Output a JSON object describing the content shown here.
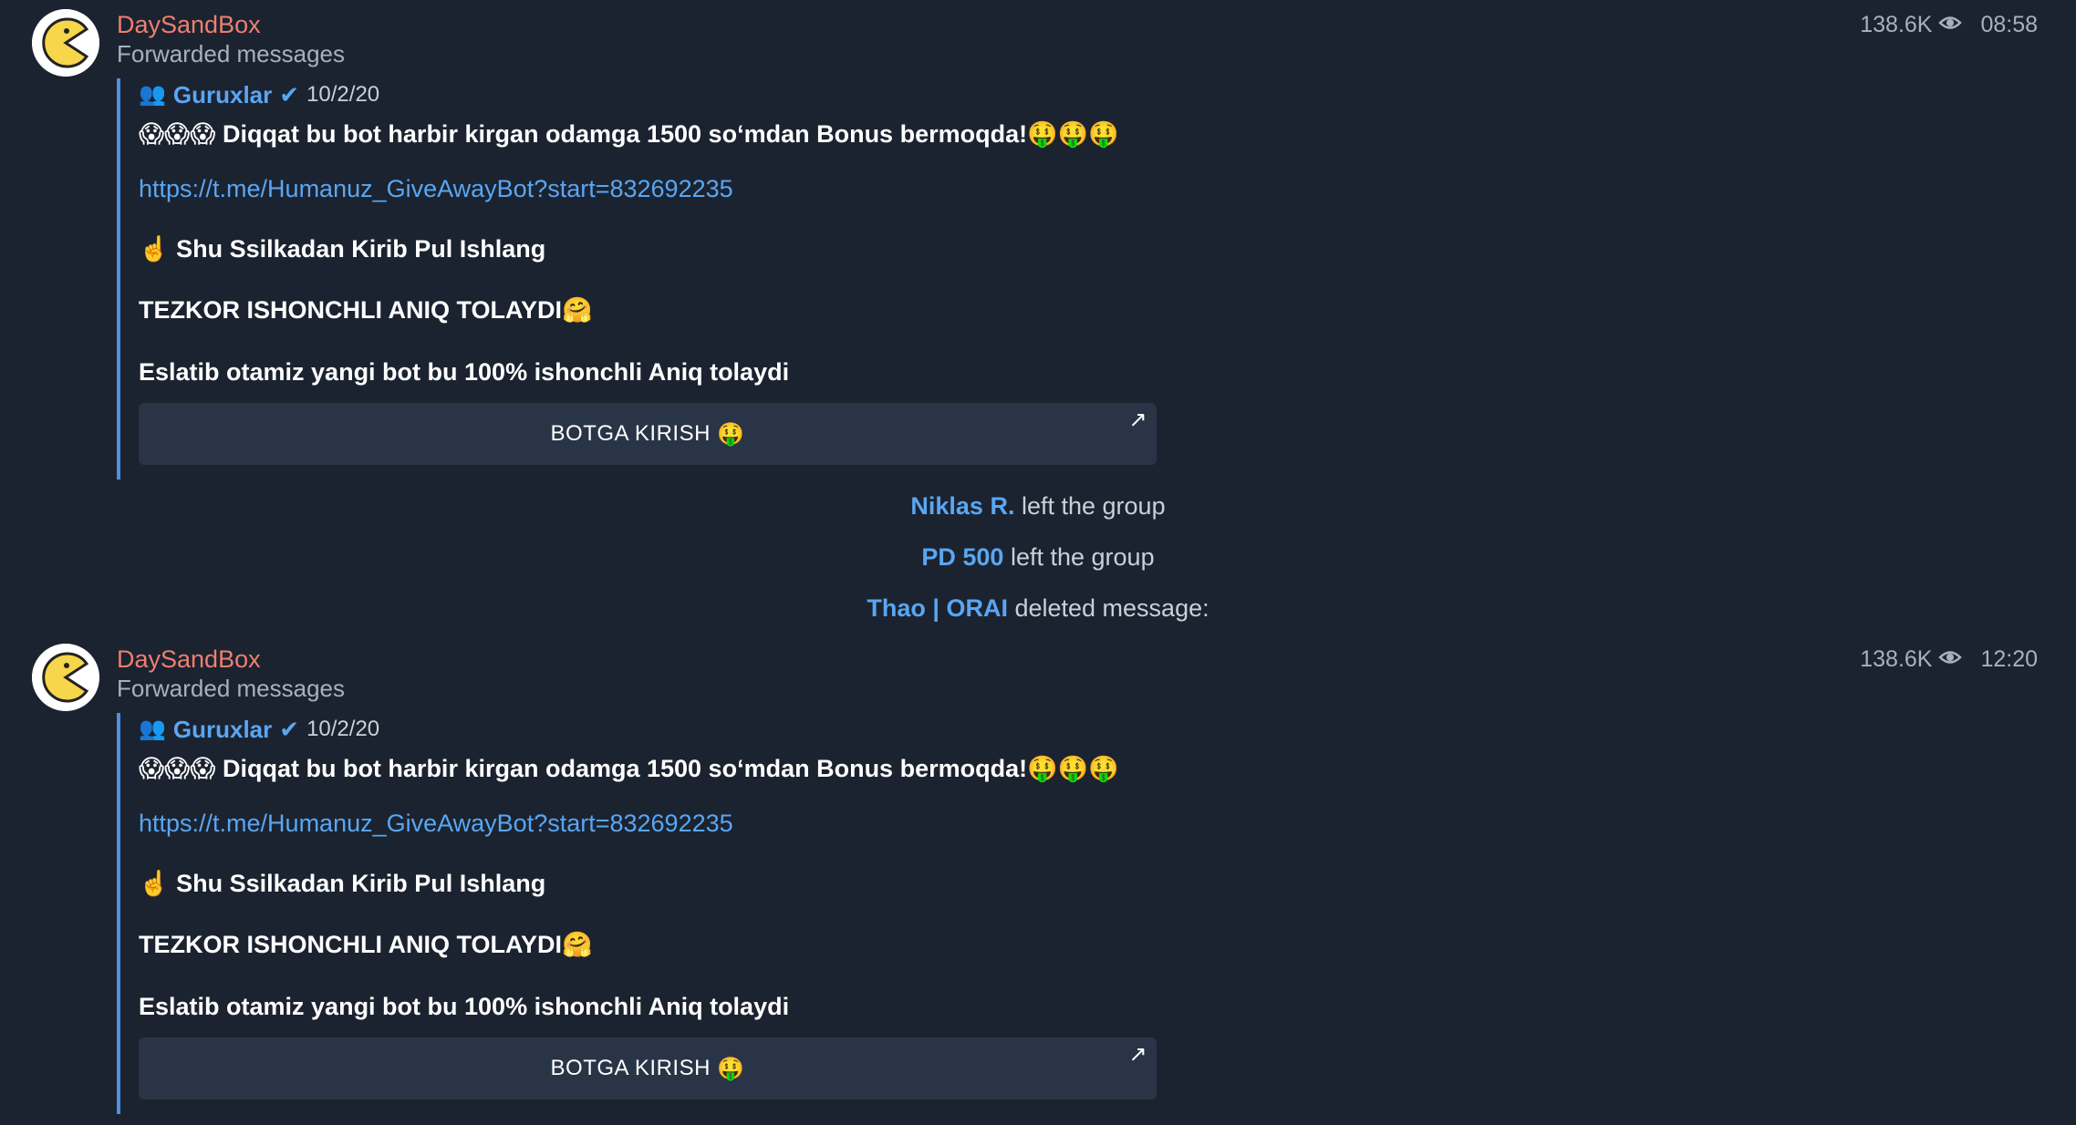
{
  "posts": [
    {
      "sender": "DaySandBox",
      "forwarded_label": "Forwarded messages",
      "views": "138.6K",
      "time": "08:58",
      "origin": {
        "group_icon": "👥",
        "name": "Guruxlar",
        "verified": "✔",
        "date": "10/2/20"
      },
      "lines": {
        "headline_emoji_start": "😱😱😱",
        "headline": "Diqqat bu bot harbir kirgan odamga 1500 so‘mdan Bonus bermoqda!",
        "headline_emoji_end": "🤑🤑🤑",
        "link": "https://t.me/Humanuz_GiveAwayBot?start=832692235",
        "pointer_emoji": "☝️",
        "cta": "Shu Ssilkadan Kirib Pul Ishlang",
        "fast": "TEZKOR ISHONCHLI ANIQ TOLAYDI",
        "fast_emoji": "🤗",
        "reminder": "Eslatib otamiz yangi bot bu 100% ishonchli Aniq tolaydi"
      },
      "button": {
        "label": "BOTGA KIRISH",
        "emoji": "🤑",
        "arrow": "↗"
      }
    },
    {
      "sender": "DaySandBox",
      "forwarded_label": "Forwarded messages",
      "views": "138.6K",
      "time": "12:20",
      "origin": {
        "group_icon": "👥",
        "name": "Guruxlar",
        "verified": "✔",
        "date": "10/2/20"
      },
      "lines": {
        "headline_emoji_start": "😱😱😱",
        "headline": "Diqqat bu bot harbir kirgan odamga 1500 so‘mdan Bonus bermoqda!",
        "headline_emoji_end": "🤑🤑🤑",
        "link": "https://t.me/Humanuz_GiveAwayBot?start=832692235",
        "pointer_emoji": "☝️",
        "cta": "Shu Ssilkadan Kirib Pul Ishlang",
        "fast": "TEZKOR ISHONCHLI ANIQ TOLAYDI",
        "fast_emoji": "🤗",
        "reminder": "Eslatib otamiz yangi bot bu 100% ishonchli Aniq tolaydi"
      },
      "button": {
        "label": "BOTGA KIRISH",
        "emoji": "🤑",
        "arrow": "↗"
      }
    }
  ],
  "service_messages": [
    {
      "who": "Niklas R.",
      "action": "left the group"
    },
    {
      "who": "PD 500",
      "action": "left the group"
    },
    {
      "who": "Thao | ORAI",
      "action": "deleted message:"
    }
  ],
  "colors": {
    "background": "#1b2330",
    "sender": "#ee7f6f",
    "link": "#5aa6f2",
    "quote_bar": "#4f8fe0",
    "button_bg": "#293446"
  }
}
